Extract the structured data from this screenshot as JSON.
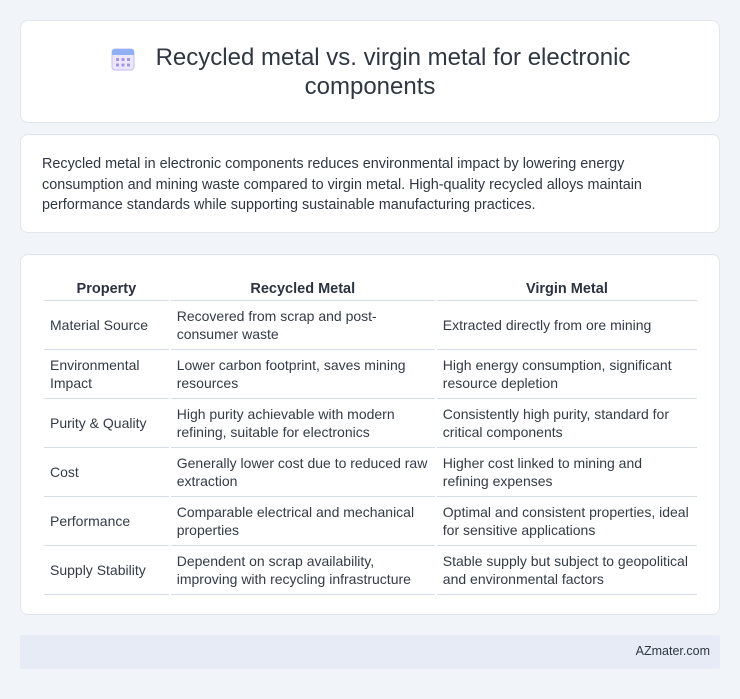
{
  "header": {
    "title_line1": "Recycled metal vs. virgin metal for electronic",
    "title_line2": "components",
    "icon": "calendar-icon"
  },
  "intro": {
    "text": "Recycled metal in electronic components reduces environmental impact by lowering energy consumption and mining waste compared to virgin metal. High-quality recycled alloys maintain performance standards while supporting sustainable manufacturing practices."
  },
  "table": {
    "headers": [
      "Property",
      "Recycled Metal",
      "Virgin Metal"
    ],
    "rows": [
      [
        "Material Source",
        "Recovered from scrap and post-consumer waste",
        "Extracted directly from ore mining"
      ],
      [
        "Environmental Impact",
        "Lower carbon footprint, saves mining resources",
        "High energy consumption, significant resource depletion"
      ],
      [
        "Purity & Quality",
        "High purity achievable with modern refining, suitable for electronics",
        "Consistently high purity, standard for critical components"
      ],
      [
        "Cost",
        "Generally lower cost due to reduced raw extraction",
        "Higher cost linked to mining and refining expenses"
      ],
      [
        "Performance",
        "Comparable electrical and mechanical properties",
        "Optimal and consistent properties, ideal for sensitive applications"
      ],
      [
        "Supply Stability",
        "Dependent on scrap availability, improving with recycling infrastructure",
        "Stable supply but subject to geopolitical and environmental factors"
      ]
    ]
  },
  "footer": {
    "brand": "AZmater.com"
  },
  "colors": {
    "background": "#f1f4f9",
    "card": "#ffffff",
    "footer": "#e6ebf5",
    "icon_accent": "#8f7ee6"
  }
}
